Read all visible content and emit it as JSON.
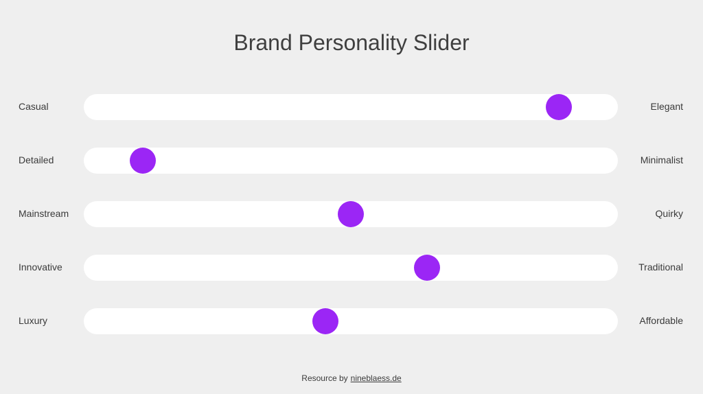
{
  "title": "Brand Personality Slider",
  "accent_color": "#9b26f5",
  "sliders": [
    {
      "left": "Casual",
      "right": "Elegant",
      "value": 0.91
    },
    {
      "left": "Detailed",
      "right": "Minimalist",
      "value": 0.09
    },
    {
      "left": "Mainstream",
      "right": "Quirky",
      "value": 0.5
    },
    {
      "left": "Innovative",
      "right": "Traditional",
      "value": 0.65
    },
    {
      "left": "Luxury",
      "right": "Affordable",
      "value": 0.45
    }
  ],
  "footer": {
    "prefix": "Resource by",
    "link_text": "nineblaess.de"
  }
}
